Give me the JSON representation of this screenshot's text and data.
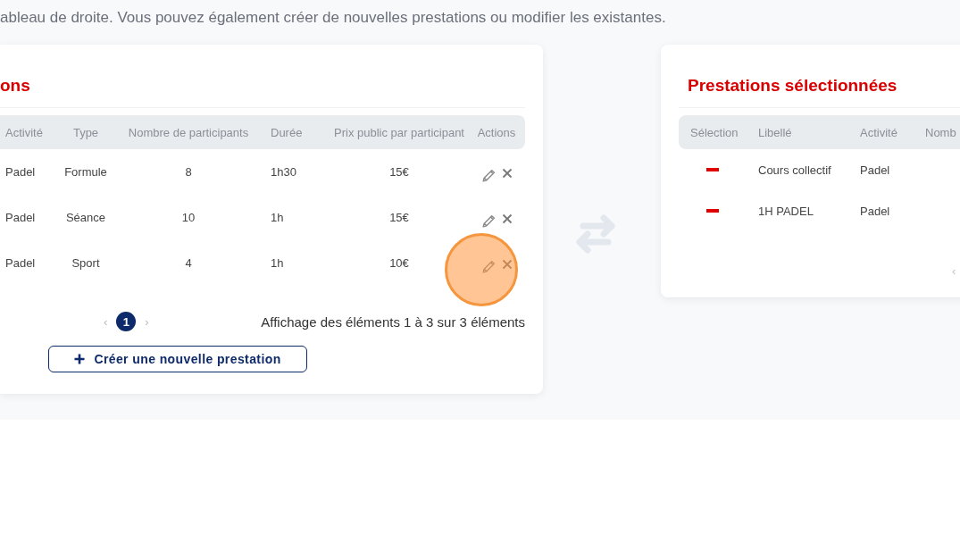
{
  "intro": "ableau de droite. Vous pouvez également créer de nouvelles prestations ou modifier les existantes.",
  "catalog": {
    "title": "ons",
    "columns": [
      "Activité",
      "Type",
      "Nombre de participants",
      "Durée",
      "Prix public par participant",
      "Actions"
    ],
    "rows": [
      {
        "activity": "Padel",
        "type": "Formule",
        "participants": "8",
        "duration": "1h30",
        "price": "15€"
      },
      {
        "activity": "Padel",
        "type": "Séance",
        "participants": "10",
        "duration": "1h",
        "price": "15€"
      },
      {
        "activity": "Padel",
        "type": "Sport",
        "participants": "4",
        "duration": "1h",
        "price": "10€"
      }
    ],
    "pagination": {
      "prev": "‹",
      "pages": [
        {
          "label": "1",
          "selected": true
        }
      ],
      "next": "›",
      "summary": "Affichage des éléments 1 à 3 sur 3 éléments"
    },
    "create_button": "Créer une nouvelle prestation"
  },
  "selected": {
    "title": "Prestations sélectionnées",
    "columns": [
      "Sélection",
      "Libellé",
      "Activité",
      "Nomb"
    ],
    "rows": [
      {
        "label": "Cours collectif",
        "activity": "Padel"
      },
      {
        "label": "1H PADEL",
        "activity": "Padel"
      }
    ],
    "pagination": {
      "prev": "‹"
    }
  }
}
